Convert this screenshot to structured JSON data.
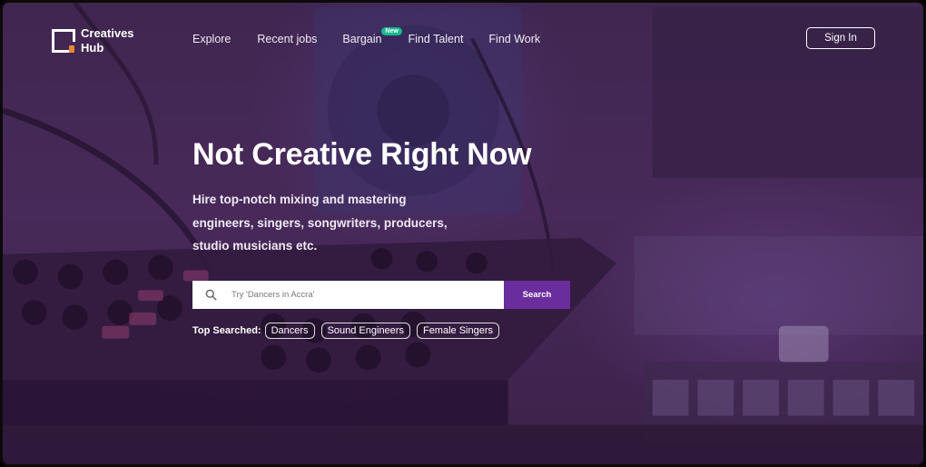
{
  "brand": {
    "name": "Creatives Hub"
  },
  "nav": {
    "items": [
      {
        "label": "Explore"
      },
      {
        "label": "Recent jobs"
      },
      {
        "label": "Bargain",
        "badge": "New"
      },
      {
        "label": "Find Talent"
      },
      {
        "label": "Find Work"
      }
    ],
    "signin_label": "Sign In"
  },
  "hero": {
    "headline": "Not Creative Right Now",
    "subtitle": "Hire top-notch mixing and mastering engineers, singers, songwriters, producers, studio musicians etc."
  },
  "search": {
    "placeholder": "Try 'Dancers in Accra'",
    "button_label": "Search",
    "icon": "search-icon"
  },
  "top_searched": {
    "label": "Top Searched:",
    "chips": [
      "Dancers",
      "Sound Engineers",
      "Female Singers"
    ]
  },
  "colors": {
    "accent": "#6a2d9e",
    "badge": "#16b98f",
    "overlay": "#4a2f5a"
  }
}
